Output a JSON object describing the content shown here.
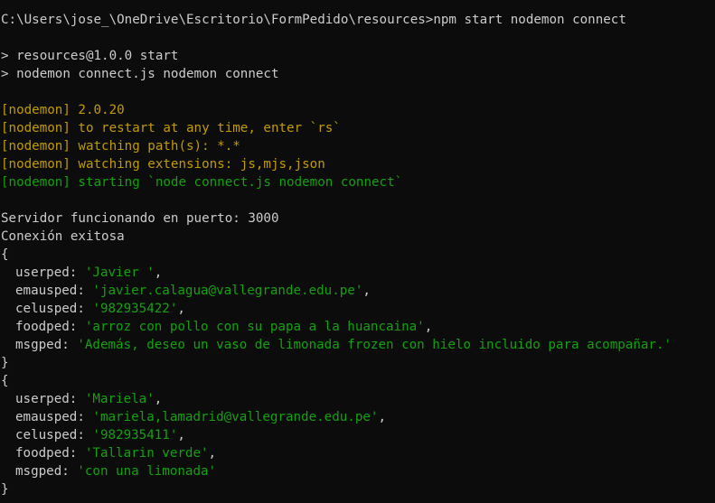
{
  "terminal": {
    "prompt_line": "C:\\Users\\jose_\\OneDrive\\Escritorio\\FormPedido\\resources>npm start nodemon connect",
    "npm_start": "> resources@1.0.0 start",
    "npm_cmd": "> nodemon connect.js nodemon connect",
    "nodemon": [
      {
        "tag": "[nodemon]",
        "text": " 2.0.20"
      },
      {
        "tag": "[nodemon]",
        "text": " to restart at any time, enter `rs`"
      },
      {
        "tag": "[nodemon]",
        "text": " watching path(s): *.*"
      },
      {
        "tag": "[nodemon]",
        "text": " watching extensions: js,mjs,json"
      },
      {
        "tag": "[nodemon]",
        "text": " starting `node connect.js nodemon connect`"
      }
    ],
    "server_msg": "Servidor funcionando en puerto: 3000",
    "conn_msg": "Conexión exitosa",
    "open_brace": "{",
    "close_brace": "}",
    "records": [
      {
        "userped_key": "userped: ",
        "userped_val": "'Javier '",
        "emausped_key": "emausped: ",
        "emausped_val": "'javier.calagua@vallegrande.edu.pe'",
        "celusped_key": "celusped: ",
        "celusped_val": "'982935422'",
        "foodped_key": "foodped: ",
        "foodped_val": "'arroz con pollo con su papa a la huancaina'",
        "msgped_key": "msgped: ",
        "msgped_val": "'Además, deseo un vaso de limonada frozen con hielo incluido para acompañar.'"
      },
      {
        "userped_key": "userped: ",
        "userped_val": "'Mariela'",
        "emausped_key": "emausped: ",
        "emausped_val": "'mariela,lamadrid@vallegrande.edu.pe'",
        "celusped_key": "celusped: ",
        "celusped_val": "'982935411'",
        "foodped_key": "foodped: ",
        "foodped_val": "'Tallarin verde'",
        "msgped_key": "msgped: ",
        "msgped_val": "'con una limonada'"
      }
    ],
    "comma": ","
  },
  "colors": {
    "background": "#0c0c0c",
    "text": "#cccccc",
    "nodemon_yellow": "#c19c00",
    "nodemon_green": "#13a10e",
    "string_green": "#13a10e"
  }
}
